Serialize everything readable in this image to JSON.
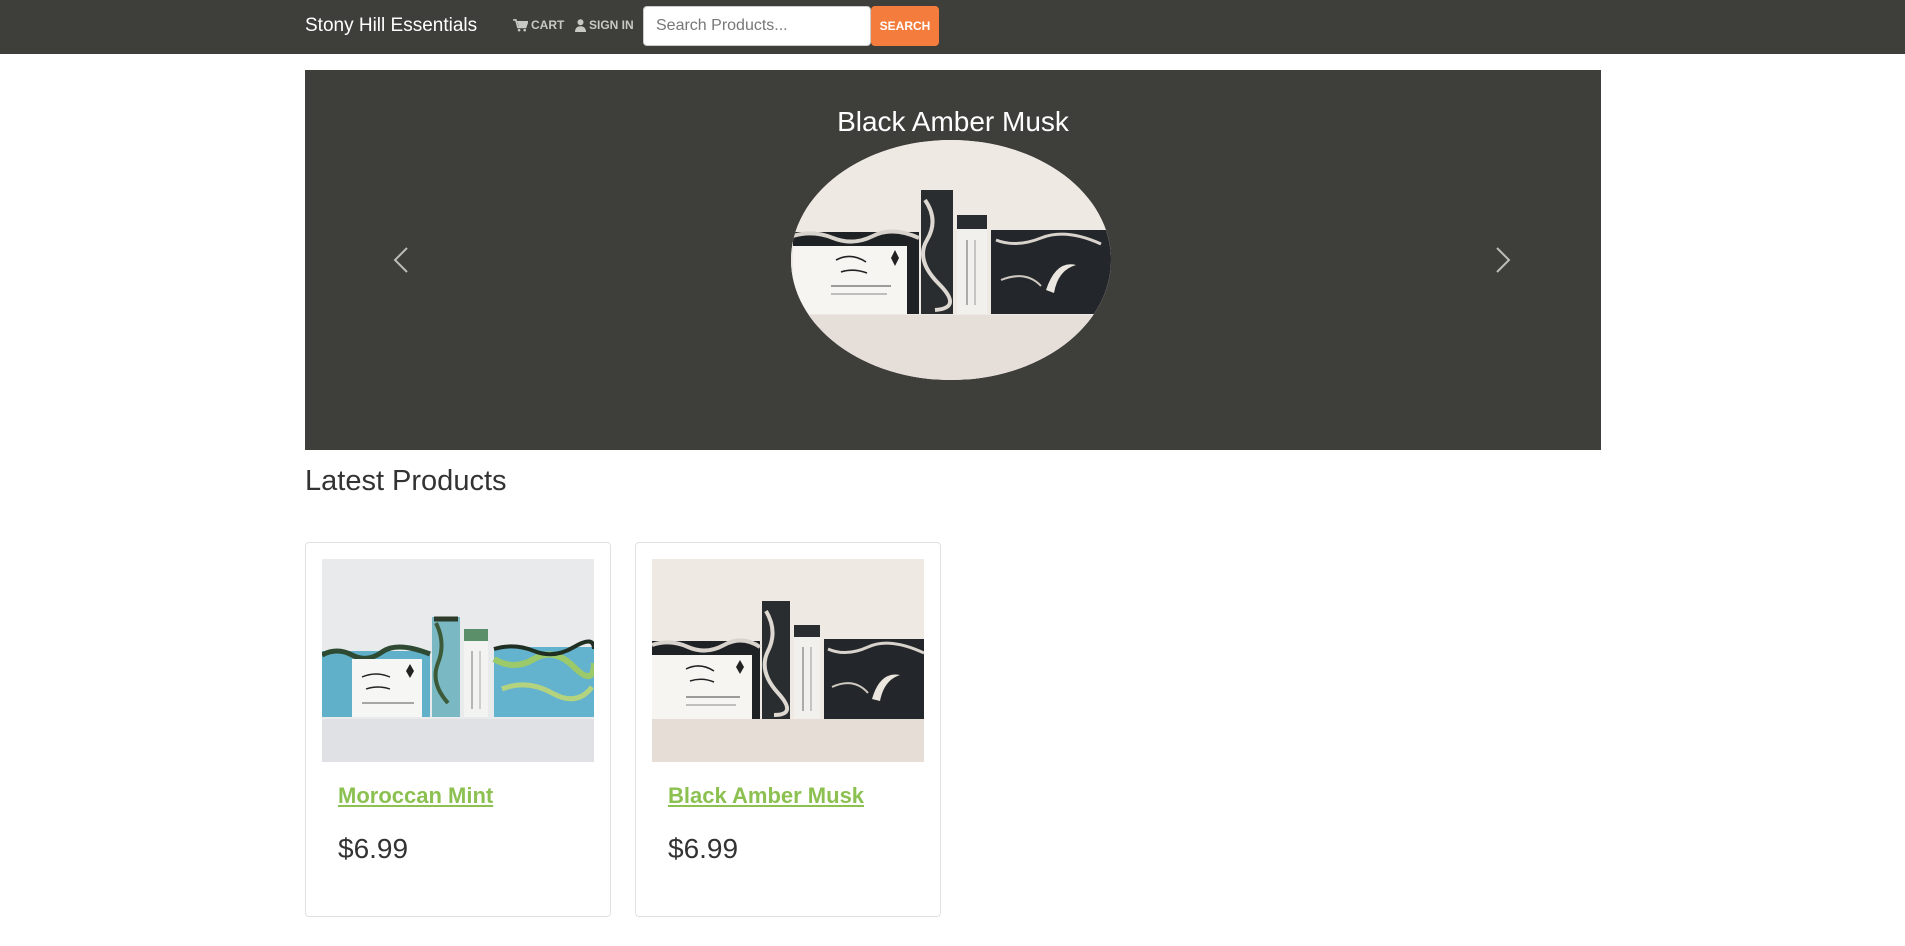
{
  "navbar": {
    "brand": "Stony Hill Essentials",
    "cart_label": "CART",
    "cart_icon": "cart-icon",
    "signin_label": "SIGN IN",
    "signin_icon": "user-icon",
    "search": {
      "placeholder": "Search Products...",
      "value": ""
    },
    "search_button_label": "SEARCH",
    "background": "#3e3e3a",
    "accent": "#f47c3c"
  },
  "carousel": {
    "title": "Black Amber Musk",
    "prev_icon": "chevron-left-icon",
    "next_icon": "chevron-right-icon"
  },
  "latest": {
    "title": "Latest Products",
    "link_color": "#8cc152",
    "products": [
      {
        "name": "Moroccan Mint",
        "price": "$6.99"
      },
      {
        "name": "Black Amber Musk",
        "price": "$6.99"
      }
    ]
  }
}
